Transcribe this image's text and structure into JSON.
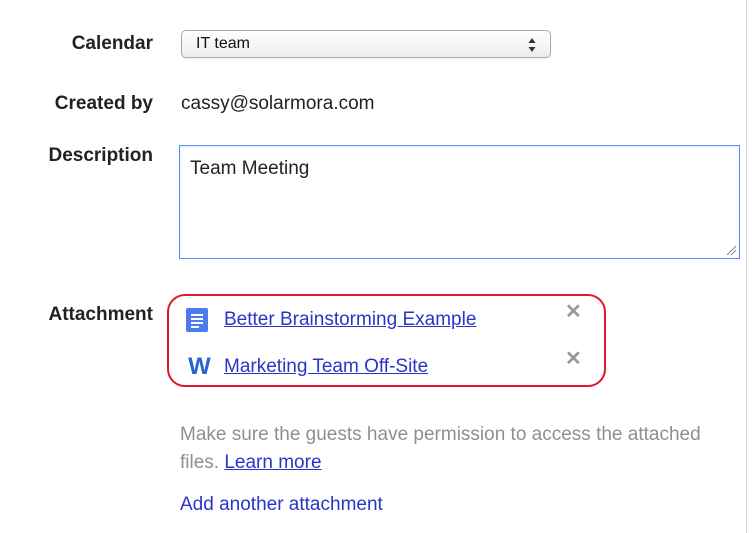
{
  "calendar": {
    "label": "Calendar",
    "selected": "IT team"
  },
  "created_by": {
    "label": "Created by",
    "value": "cassy@solarmora.com"
  },
  "description": {
    "label": "Description",
    "value": "Team Meeting"
  },
  "attachment": {
    "label": "Attachment",
    "items": [
      {
        "name": "Better Brainstorming Example",
        "icon": "google-doc-icon"
      },
      {
        "name": "Marketing Team Off-Site",
        "icon": "word-doc-icon",
        "icon_text": "W"
      }
    ],
    "remove_glyph": "✕"
  },
  "hint": {
    "text": "Make sure the guests have permission to access the attached files.",
    "link": "Learn more"
  },
  "add_attachment": "Add another attachment",
  "colors": {
    "link": "#2a35c8",
    "highlight": "#e2182a",
    "focus": "#4d90fe",
    "doc_icon": "#4b7bee",
    "word_icon": "#2a63d4"
  }
}
